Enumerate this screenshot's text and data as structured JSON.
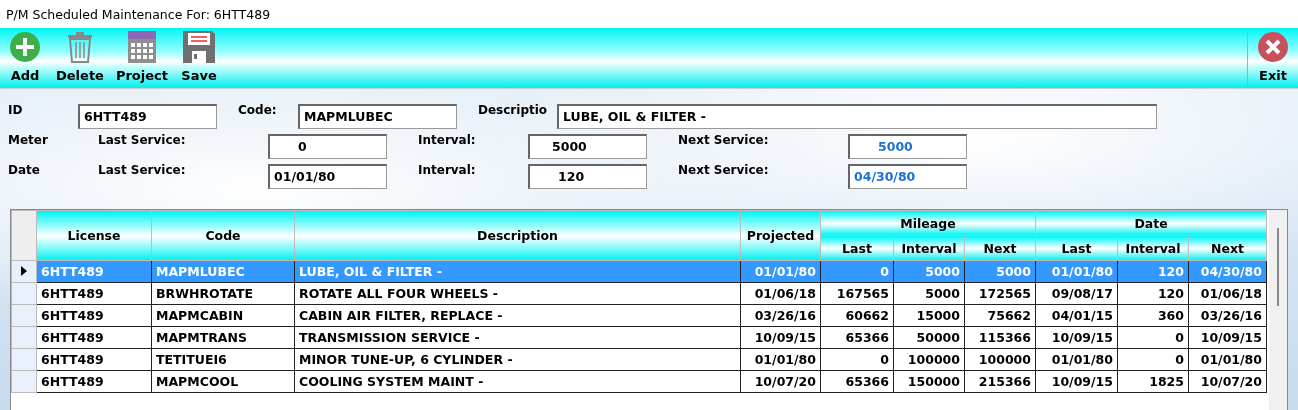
{
  "window": {
    "title": "P/M Scheduled Maintenance For: 6HTT489"
  },
  "toolbar": {
    "buttons": [
      {
        "label": "Add",
        "kind": "add"
      },
      {
        "label": "Delete",
        "kind": "delete"
      },
      {
        "label": "Project",
        "kind": "project"
      },
      {
        "label": "Save",
        "kind": "save"
      }
    ],
    "exit": {
      "label": "Exit",
      "kind": "exit"
    }
  },
  "form": {
    "id": {
      "label": "ID",
      "value": "6HTT489"
    },
    "code": {
      "label": "Code:",
      "value": "MAPMLUBEC"
    },
    "description": {
      "label": "Descriptio",
      "value": "LUBE, OIL & FILTER -"
    },
    "rows": [
      {
        "label": "Meter",
        "last_label": "Last Service:",
        "last": "0",
        "interval_label": "Interval:",
        "interval": "5000",
        "next_label": "Next Service:",
        "next": "5000"
      },
      {
        "label": "Date",
        "last_label": "Last Service:",
        "last": "01/01/80",
        "interval_label": "Interval:",
        "interval": "120",
        "next_label": "Next Service:",
        "next": "04/30/80"
      }
    ]
  },
  "table": {
    "columns": [
      "License",
      "Code",
      "Description",
      "Projected"
    ],
    "groups": [
      {
        "label": "Mileage",
        "columns": [
          "Last",
          "Interval",
          "Next"
        ]
      },
      {
        "label": "Date",
        "columns": [
          "Last",
          "Interval",
          "Next"
        ]
      }
    ],
    "rows": [
      {
        "selected": true,
        "cells": [
          "6HTT489",
          "MAPMLUBEC",
          "LUBE, OIL & FILTER -",
          "01/01/80",
          "0",
          "5000",
          "5000",
          "01/01/80",
          "120",
          "04/30/80"
        ]
      },
      {
        "selected": false,
        "cells": [
          "6HTT489",
          "BRWHROTATE",
          "ROTATE ALL FOUR WHEELS -",
          "01/06/18",
          "167565",
          "5000",
          "172565",
          "09/08/17",
          "120",
          "01/06/18"
        ]
      },
      {
        "selected": false,
        "cells": [
          "6HTT489",
          "MAPMCABIN",
          "CABIN AIR FILTER, REPLACE -",
          "03/26/16",
          "60662",
          "15000",
          "75662",
          "04/01/15",
          "360",
          "03/26/16"
        ]
      },
      {
        "selected": false,
        "cells": [
          "6HTT489",
          "MAPMTRANS",
          "TRANSMISSION SERVICE -",
          "10/09/15",
          "65366",
          "50000",
          "115366",
          "10/09/15",
          "0",
          "10/09/15"
        ]
      },
      {
        "selected": false,
        "cells": [
          "6HTT489",
          "TETITUEI6",
          "MINOR TUNE-UP, 6 CYLINDER -",
          "01/01/80",
          "0",
          "100000",
          "100000",
          "01/01/80",
          "0",
          "01/01/80"
        ]
      },
      {
        "selected": false,
        "cells": [
          "6HTT489",
          "MAPMCOOL",
          "COOLING SYSTEM MAINT -",
          "10/07/20",
          "65366",
          "150000",
          "215366",
          "10/09/15",
          "1825",
          "10/07/20"
        ]
      }
    ]
  }
}
